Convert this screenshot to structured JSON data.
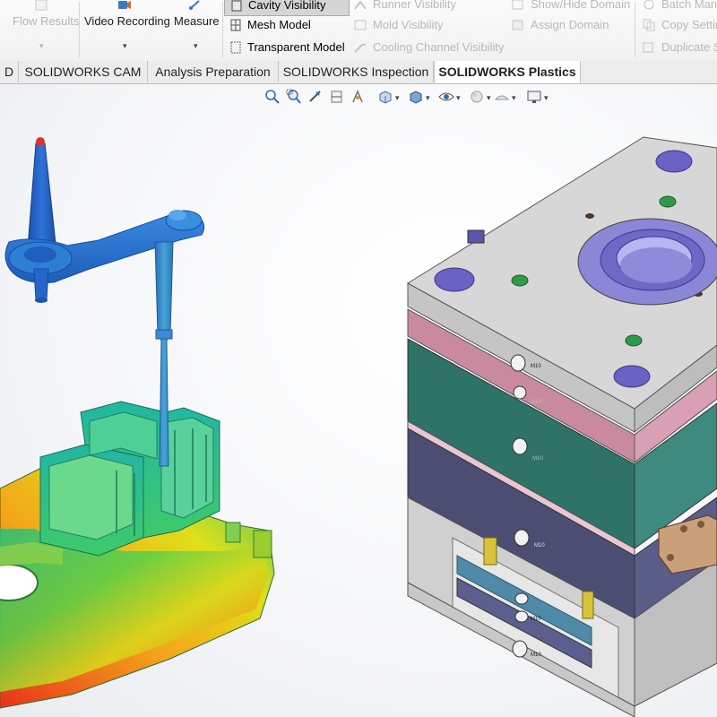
{
  "ribbon": {
    "flow_results": "Flow Results",
    "video_recording": "Video Recording",
    "measure": "Measure",
    "cavity_visibility": "Cavity Visibility",
    "mesh_model": "Mesh Model",
    "transparent_model": "Transparent Model",
    "runner_visibility": "Runner Visibility",
    "mold_visibility": "Mold Visibility",
    "cooling_channel_visibility": "Cooling Channel Visibility",
    "show_hide_domain": "Show/Hide Domain",
    "assign_domain": "Assign Domain",
    "batch_manager": "Batch Man",
    "copy_settings": "Copy Settin",
    "duplicate": "Duplicate S"
  },
  "tabs": [
    {
      "label": "D"
    },
    {
      "label": "SOLIDWORKS CAM"
    },
    {
      "label": "Analysis Preparation"
    },
    {
      "label": "SOLIDWORKS Inspection"
    },
    {
      "label": "SOLIDWORKS Plastics",
      "active": true
    }
  ],
  "heads_up_toolbar": [
    "zoom-to-fit-icon",
    "zoom-area-icon",
    "previous-view-icon",
    "section-view-icon",
    "dynamic-annotation-icon",
    "view-orientation-icon",
    "display-style-icon",
    "hide-show-items-icon",
    "edit-appearance-icon",
    "apply-scene-icon",
    "view-settings-icon"
  ],
  "mold_labels": [
    "M10",
    "M10",
    "M10",
    "M10",
    "M10",
    "M10"
  ],
  "colors": {
    "accent": "#1e73be",
    "mold_top": "#d6d6d6",
    "plate_pink": "#c98aa0",
    "plate_teal": "#2f7268",
    "plate_purple": "#4b4e72",
    "runner_blue": "#2b6fc0"
  }
}
